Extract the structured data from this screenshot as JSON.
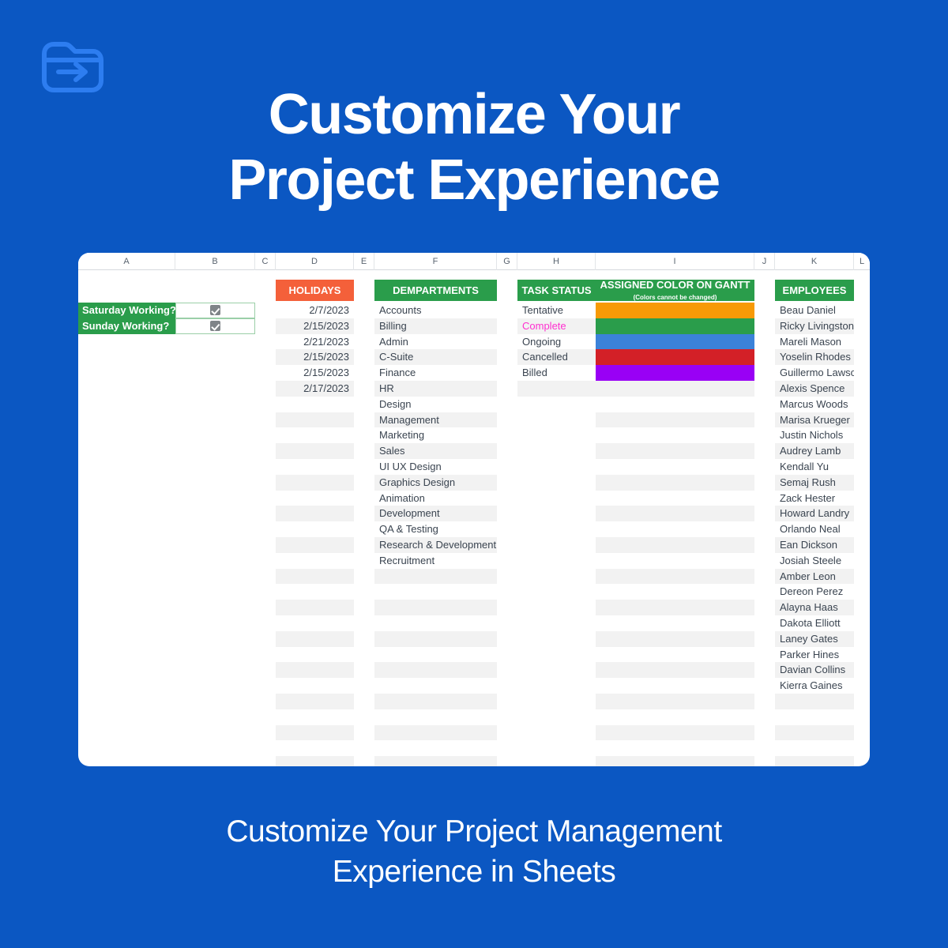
{
  "page": {
    "background_color": "#0B57C2",
    "logo_icon": "folder-arrow-icon",
    "headline_line1": "Customize Your",
    "headline_line2": "Project Experience",
    "caption_line1": "Customize Your Project Management",
    "caption_line2": "Experience in Sheets"
  },
  "spreadsheet": {
    "column_headers": [
      "A",
      "B",
      "C",
      "D",
      "E",
      "F",
      "G",
      "H",
      "I",
      "J",
      "K",
      "L"
    ],
    "section_headers": {
      "holidays": "HOLIDAYS",
      "departments": "DEMPARTMENTS",
      "task_status": "TASK STATUS",
      "assigned_color_main": "ASSIGNED COLOR ON GANTT",
      "assigned_color_note": "(Colors cannot be changed)",
      "employees": "EMPLOYEES"
    },
    "header_colors": {
      "holidays": "#F4603A",
      "green": "#2A9D4B"
    },
    "settings": [
      {
        "label": "Saturday Working?",
        "checked": true
      },
      {
        "label": "Sunday Working?",
        "checked": true
      }
    ],
    "holidays": [
      "2/7/2023",
      "2/15/2023",
      "2/21/2023",
      "2/15/2023",
      "2/15/2023",
      "2/17/2023"
    ],
    "departments": [
      "Accounts",
      "Billing",
      "Admin",
      "C-Suite",
      "Finance",
      "HR",
      "Design",
      "Management",
      "Marketing",
      "Sales",
      "UI UX Design",
      "Graphics Design",
      "Animation",
      "Development",
      "QA & Testing",
      "Research & Development",
      "Recruitment"
    ],
    "task_status": [
      {
        "label": "Tentative",
        "color": "#F79A07",
        "text_color": "#3a4450"
      },
      {
        "label": "Complete",
        "color": "#2A9D4B",
        "text_color": "#FF2FD0"
      },
      {
        "label": "Ongoing",
        "color": "#3B82D9",
        "text_color": "#3a4450"
      },
      {
        "label": "Cancelled",
        "color": "#D32027",
        "text_color": "#3a4450"
      },
      {
        "label": "Billed",
        "color": "#9900F5",
        "text_color": "#3a4450"
      }
    ],
    "employees": [
      "Beau Daniel",
      "Ricky Livingston",
      "Mareli Mason",
      "Yoselin Rhodes",
      "Guillermo Lawson",
      "Alexis Spence",
      "Marcus Woods",
      "Marisa Krueger",
      "Justin Nichols",
      "Audrey Lamb",
      "Kendall Yu",
      "Semaj Rush",
      "Zack Hester",
      "Howard Landry",
      "Orlando Neal",
      "Ean Dickson",
      "Josiah Steele",
      "Amber Leon",
      "Dereon Perez",
      "Alayna Haas",
      "Dakota Elliott",
      "Laney Gates",
      "Parker Hines",
      "Davian Collins",
      "Kierra Gaines"
    ]
  }
}
